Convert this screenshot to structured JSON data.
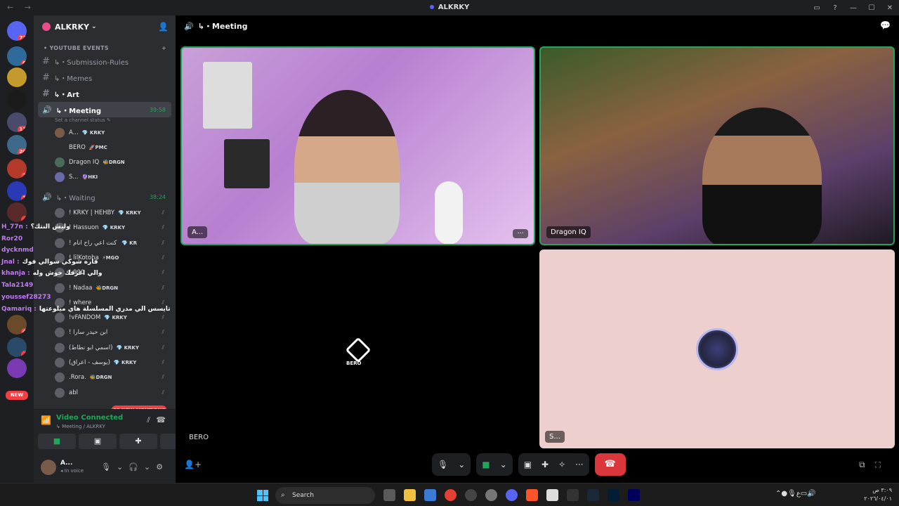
{
  "window": {
    "title": "ALKRKY",
    "controls": [
      "▭",
      "?",
      "—",
      "☐",
      "✕"
    ]
  },
  "guilds": [
    {
      "name": "dm",
      "badge": "723",
      "color": "#5865f2"
    },
    {
      "name": "server-1",
      "badge": "68",
      "color": "#2f6b9a"
    },
    {
      "name": "server-2",
      "badge": "",
      "color": "#c49a2c"
    },
    {
      "name": "cloud",
      "badge": "",
      "color": "#1b1b1b"
    },
    {
      "name": "server-4",
      "badge": "116",
      "color": "#4a4a6a"
    },
    {
      "name": "server-5",
      "badge": "208",
      "color": "#3d6a8a"
    },
    {
      "name": "server-6",
      "badge": "27",
      "color": "#b43a2a"
    },
    {
      "name": "server-7",
      "badge": "17",
      "color": "#2a3ab4"
    },
    {
      "name": "server-8",
      "badge": "4",
      "color": "#5a2a2a"
    },
    {
      "name": "server-9",
      "badge": "46",
      "color": "#6a4a2a"
    },
    {
      "name": "server-10",
      "badge": "3",
      "color": "#2a4a6a"
    },
    {
      "name": "server-11",
      "badge": "",
      "color": "#7a3ab4"
    }
  ],
  "new_label": "NEW",
  "server": {
    "name": "ALKRKY"
  },
  "category": "• YOUTUBE EVENTS",
  "text_channels": [
    "↳・Submission-Rules",
    "↳・Memes",
    "↳・Art"
  ],
  "meeting": {
    "name": "↳・Meeting",
    "time": "39:58",
    "status": "Set a channel status"
  },
  "meeting_members": [
    {
      "name": "A...",
      "tag": "💎 KRKY",
      "color": "#7a5a48"
    },
    {
      "name": "BERO",
      "tag": "🚀PMC",
      "color": "#2b2d31"
    },
    {
      "name": "Dragon IQ",
      "tag": "🐝DRGN",
      "color": "#4a6a5a"
    },
    {
      "name": "S...",
      "tag": "🔮HKI",
      "color": "#6a6aaa"
    }
  ],
  "waiting": {
    "name": "↳・Waiting",
    "time": "38:24"
  },
  "waiting_members": [
    {
      "name": "! KRKY | HEHBY",
      "tag": "💎 KRKY"
    },
    {
      "name": "! Hassuon",
      "tag": "💎 KRKY"
    },
    {
      "name": "! ابجي كنت اعي راح انام",
      "tag": "💎 KR"
    },
    {
      "name": "! lilKotoha",
      "tag": "⚡MGO"
    },
    {
      "name": "! 990",
      "tag": ""
    },
    {
      "name": "! Nadaa",
      "tag": "🐝DRGN"
    },
    {
      "name": "! where",
      "tag": ""
    },
    {
      "name": "!vFANDOM",
      "tag": "💎 KRKY"
    },
    {
      "name": "! ابن حيدر سارا",
      "tag": ""
    },
    {
      "name": "(اسمي ابو نطاط)",
      "tag": "💎 KRKY"
    },
    {
      "name": "(يوسف - اعراق)",
      "tag": "💎 KRKY"
    },
    {
      "name": ".Rora.",
      "tag": "🐝DRGN"
    },
    {
      "name": "abl",
      "tag": ""
    }
  ],
  "stream_overlay": [
    {
      "name": "H_77n",
      "msg": "وليش النتك؟"
    },
    {
      "name": "Ror20",
      "msg": ""
    },
    {
      "name": "dycknmd",
      "msg": ""
    },
    {
      "name": "Jnal",
      "msg": "قاره شوكي سوالي فوك"
    },
    {
      "name": "khanja",
      "msg": "والي اعرفك خوش وله"
    },
    {
      "name": "Tala2149",
      "msg": ""
    },
    {
      "name": "youssef28273",
      "msg": ""
    },
    {
      "name": "Qamariq",
      "msg": "تايسس الي مدري المسلسلة هاي ميلوعتها"
    }
  ],
  "mentions": "68 NEW MENTIONS",
  "voice_panel": {
    "connected": "Video Connected",
    "location": "↳ Meeting / ALKRKY"
  },
  "user_panel": {
    "name": "A...",
    "status": "In voice"
  },
  "main": {
    "channel_title": "↳・Meeting",
    "tiles": [
      {
        "label": "A..."
      },
      {
        "label": "Dragon IQ"
      },
      {
        "label": "BERO",
        "logo_text": "BERO"
      },
      {
        "label": "S..."
      }
    ],
    "more": "···"
  },
  "taskbar": {
    "search_placeholder": "Search",
    "clock_time": "٣:٠٩ ص",
    "clock_date": "٢٠٢٦/٠٤/٠١",
    "lang": "ع"
  }
}
